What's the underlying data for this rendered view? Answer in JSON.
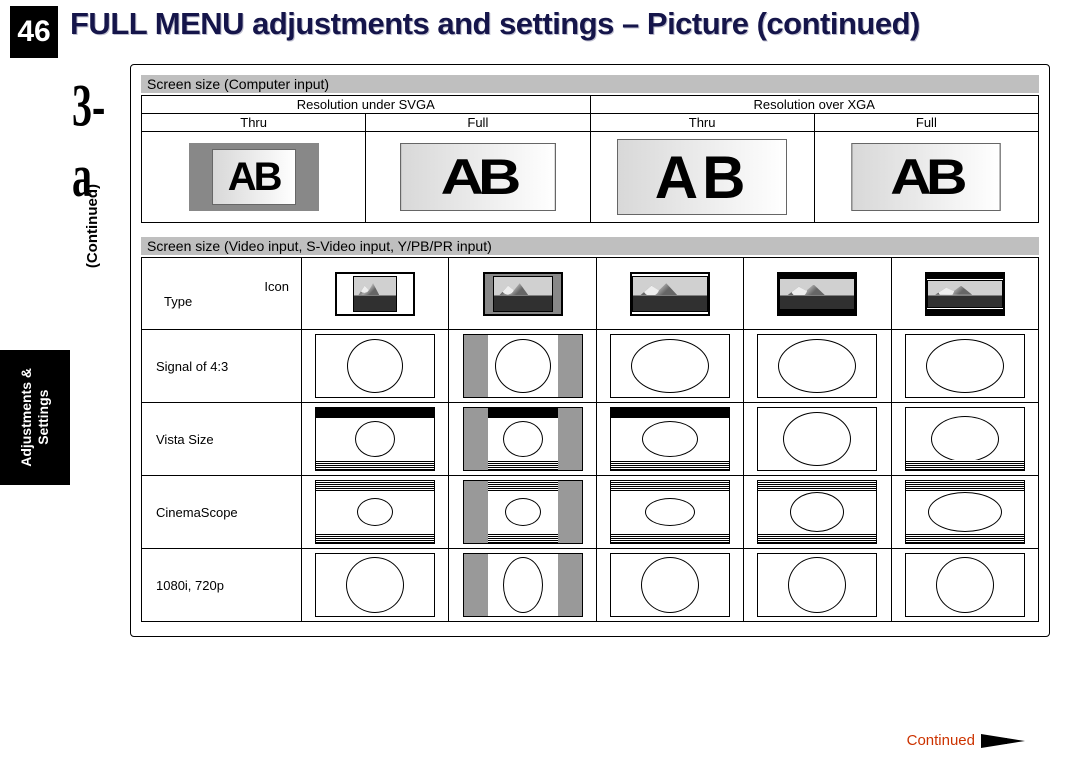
{
  "page_number": "46",
  "title": "FULL MENU adjustments and settings – Picture (continued)",
  "section_label": "3-a",
  "continued_vertical": "(Continued)",
  "side_tab_line1": "Adjustments &",
  "side_tab_line2": "Settings",
  "computer_input": {
    "header": "Screen size (Computer input)",
    "col_group_a": "Resolution under SVGA",
    "col_group_b": "Resolution over XGA",
    "sub_a1": "Thru",
    "sub_a2": "Full",
    "sub_b1": "Thru",
    "sub_b2": "Full",
    "sample_text": "AB"
  },
  "video_input": {
    "header": "Screen size (Video input, S-Video input, Y/PB/PR input)",
    "corner_icon": "Icon",
    "corner_type": "Type",
    "rows": {
      "r1": "Signal of 4:3",
      "r2": "Vista Size",
      "r3": "CinemaScope",
      "r4": "1080i, 720p"
    }
  },
  "footer_continued": "Continued"
}
